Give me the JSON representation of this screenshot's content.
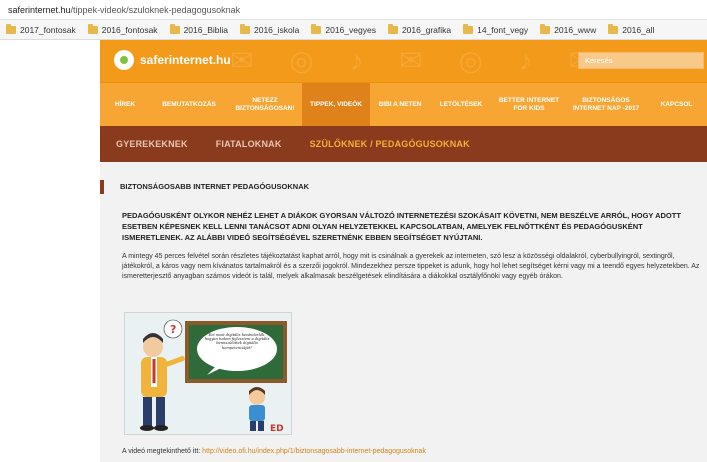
{
  "browser": {
    "url_host": "saferinternet.hu",
    "url_path": "/tippek-videok/szuloknek-pedagogusoknak",
    "bookmarks": [
      "2017_fontosak",
      "2016_fontosak",
      "2016_Biblia",
      "2016_iskola",
      "2016_vegyes",
      "2016_grafika",
      "14_font_vegy",
      "2016_www",
      "2016_all"
    ]
  },
  "site": {
    "logo_text": "saferinternet.hu",
    "search_placeholder": "Keresés",
    "main_nav": [
      {
        "label": "HÍREK"
      },
      {
        "label": "BEMUTATKOZÁS"
      },
      {
        "label": "NETEZZ BIZTONSÁGOSAN!"
      },
      {
        "label": "TIPPEK, VIDEÓK",
        "active": true
      },
      {
        "label": "BIBI A NETEN"
      },
      {
        "label": "LETÖLTÉSEK"
      },
      {
        "label": "BETTER INTERNET FOR KIDS"
      },
      {
        "label": "BIZTONSÁGOS INTERNET NAP -2017"
      },
      {
        "label": "KAPCSOL"
      }
    ],
    "sub_nav": [
      {
        "label": "GYEREKEKNEK"
      },
      {
        "label": "FIATALOKNAK"
      },
      {
        "label": "SZÜLŐKNEK / PEDAGÓGUSOKNAK",
        "active": true
      }
    ]
  },
  "article": {
    "title": "BIZTONSÁGOSABB INTERNET PEDAGÓGUSOKNAK",
    "lead": "PEDAGÓGUSKÉNT OLYKOR NEHÉZ LEHET A DIÁKOK GYORSAN VÁLTOZÓ INTERNETEZÉSI SZOKÁSAIT KÖVETNI, NEM BESZÉLVE ARRÓL, HOGY ADOTT ESETBEN KÉPESNEK KELL LENNI TANÁCSOT ADNI OLYAN HELYZETEKKEL KAPCSOLATBAN, AMELYEK FELNŐTTKÉNT ÉS PEDAGÓGUSKÉNT ISMERETLENEK. AZ ALÁBBI VIDEÓ SEGÍTSÉGÉVEL SZERETNÉNK EBBEN SEGÍTSÉGET NYÚJTANI.",
    "body": "A mintegy 45 perces felvétel során részletes tájékoztatást kaphat arról, hogy mit is csinálnak a gyerekek az interneten, szó lesz a közösségi oldalakról, cyberbullyingról, sextingről, játékokról, a káros vagy nem kívánatos tartalmakról és a szerzői jogokról. Mindezekhez persze tippeket is adunk, hogy hol lehet segítséget kérni vagy mi a teendő egyes helyzetekben. Az ismeretterjesztő anyagban számos videót is talál, melyek alkalmasak beszélgetések elindítására a diákokkal osztályfőnöki vagy egyéb órákon.",
    "board_text": "Ezt most digitális bevándorlók, hogyan tudom fejleszteni a digitális bennszülöttek digitális kompetenciáját?",
    "video_brand": "ED",
    "link_prefix": "A videó megtekinthető itt:",
    "link_url": "http://video.ofi.hu/index.php/1/biztonsagosabb-internet-pedagogusoknak"
  },
  "colors": {
    "orange": "#f49a1a",
    "nav_orange": "#f7a634",
    "brown": "#8a3a1d",
    "board_green": "#2f6b3a"
  }
}
